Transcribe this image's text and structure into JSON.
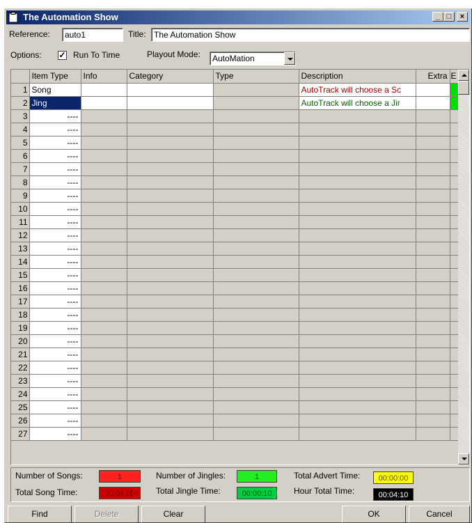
{
  "window": {
    "title": "The Automation Show",
    "minimize_glyph": "_",
    "maximize_glyph": "□",
    "close_glyph": "×"
  },
  "form": {
    "reference_label": "Reference:",
    "reference_value": "auto1",
    "title_label": "Title:",
    "title_value": "The Automation Show",
    "options_label": "Options:",
    "run_to_time_label": "Run To Time",
    "run_to_time_checked": true,
    "playout_mode_label": "Playout Mode:",
    "playout_mode_value": "AutoMation"
  },
  "grid": {
    "columns": [
      "Item Type",
      "Info",
      "Category",
      "Type",
      "Description",
      "Extra",
      "E"
    ],
    "rows": [
      {
        "num": "1",
        "item_type": "Song",
        "description": "AutoTrack will choose a Sc",
        "desc_color": "red"
      },
      {
        "num": "2",
        "item_type": "Jing",
        "description": "AutoTrack will choose a Jir",
        "desc_color": "green"
      }
    ],
    "empty_rows": [
      "3",
      "4",
      "5",
      "6",
      "7",
      "8",
      "9",
      "10",
      "11",
      "12",
      "13",
      "14",
      "15",
      "16",
      "17",
      "18",
      "19",
      "20",
      "21",
      "22",
      "23",
      "24",
      "25",
      "26",
      "27"
    ],
    "empty_marker": "----"
  },
  "stats": {
    "num_songs_label": "Number of Songs:",
    "num_songs_value": "1",
    "total_song_time_label": "Total Song Time:",
    "total_song_time_value": "00:04:00",
    "num_jingles_label": "Number of Jingles:",
    "num_jingles_value": "1",
    "total_jingle_time_label": "Total Jingle Time:",
    "total_jingle_time_value": "00:00:10",
    "total_advert_time_label": "Total Advert Time:",
    "total_advert_time_value": "00:00:00",
    "hour_total_time_label": "Hour Total Time:",
    "hour_total_time_value": "00:04:10"
  },
  "buttons": {
    "find": "Find",
    "delete": "Delete",
    "clear": "Clear",
    "ok": "OK",
    "cancel": "Cancel"
  },
  "colors": {
    "title_bar": "#0a246a",
    "song_box": "#ff2020",
    "song_time_box": "#cc0000",
    "jingle_box": "#22ee22",
    "jingle_time_box": "#00cc44",
    "advert_box": "#ffff00",
    "hour_box": "#000000",
    "extra_green": "#00e000"
  }
}
